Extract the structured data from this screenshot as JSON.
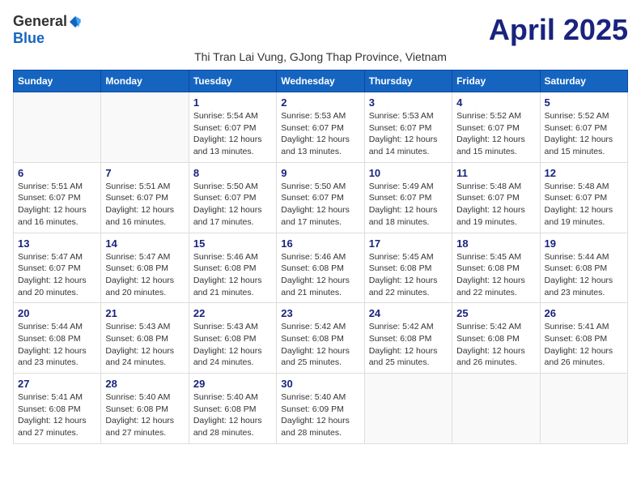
{
  "logo": {
    "general": "General",
    "blue": "Blue"
  },
  "title": "April 2025",
  "subtitle": "Thi Tran Lai Vung, GJong Thap Province, Vietnam",
  "days_of_week": [
    "Sunday",
    "Monday",
    "Tuesday",
    "Wednesday",
    "Thursday",
    "Friday",
    "Saturday"
  ],
  "weeks": [
    [
      {
        "day": "",
        "info": ""
      },
      {
        "day": "",
        "info": ""
      },
      {
        "day": "1",
        "info": "Sunrise: 5:54 AM\nSunset: 6:07 PM\nDaylight: 12 hours and 13 minutes."
      },
      {
        "day": "2",
        "info": "Sunrise: 5:53 AM\nSunset: 6:07 PM\nDaylight: 12 hours and 13 minutes."
      },
      {
        "day": "3",
        "info": "Sunrise: 5:53 AM\nSunset: 6:07 PM\nDaylight: 12 hours and 14 minutes."
      },
      {
        "day": "4",
        "info": "Sunrise: 5:52 AM\nSunset: 6:07 PM\nDaylight: 12 hours and 15 minutes."
      },
      {
        "day": "5",
        "info": "Sunrise: 5:52 AM\nSunset: 6:07 PM\nDaylight: 12 hours and 15 minutes."
      }
    ],
    [
      {
        "day": "6",
        "info": "Sunrise: 5:51 AM\nSunset: 6:07 PM\nDaylight: 12 hours and 16 minutes."
      },
      {
        "day": "7",
        "info": "Sunrise: 5:51 AM\nSunset: 6:07 PM\nDaylight: 12 hours and 16 minutes."
      },
      {
        "day": "8",
        "info": "Sunrise: 5:50 AM\nSunset: 6:07 PM\nDaylight: 12 hours and 17 minutes."
      },
      {
        "day": "9",
        "info": "Sunrise: 5:50 AM\nSunset: 6:07 PM\nDaylight: 12 hours and 17 minutes."
      },
      {
        "day": "10",
        "info": "Sunrise: 5:49 AM\nSunset: 6:07 PM\nDaylight: 12 hours and 18 minutes."
      },
      {
        "day": "11",
        "info": "Sunrise: 5:48 AM\nSunset: 6:07 PM\nDaylight: 12 hours and 19 minutes."
      },
      {
        "day": "12",
        "info": "Sunrise: 5:48 AM\nSunset: 6:07 PM\nDaylight: 12 hours and 19 minutes."
      }
    ],
    [
      {
        "day": "13",
        "info": "Sunrise: 5:47 AM\nSunset: 6:07 PM\nDaylight: 12 hours and 20 minutes."
      },
      {
        "day": "14",
        "info": "Sunrise: 5:47 AM\nSunset: 6:08 PM\nDaylight: 12 hours and 20 minutes."
      },
      {
        "day": "15",
        "info": "Sunrise: 5:46 AM\nSunset: 6:08 PM\nDaylight: 12 hours and 21 minutes."
      },
      {
        "day": "16",
        "info": "Sunrise: 5:46 AM\nSunset: 6:08 PM\nDaylight: 12 hours and 21 minutes."
      },
      {
        "day": "17",
        "info": "Sunrise: 5:45 AM\nSunset: 6:08 PM\nDaylight: 12 hours and 22 minutes."
      },
      {
        "day": "18",
        "info": "Sunrise: 5:45 AM\nSunset: 6:08 PM\nDaylight: 12 hours and 22 minutes."
      },
      {
        "day": "19",
        "info": "Sunrise: 5:44 AM\nSunset: 6:08 PM\nDaylight: 12 hours and 23 minutes."
      }
    ],
    [
      {
        "day": "20",
        "info": "Sunrise: 5:44 AM\nSunset: 6:08 PM\nDaylight: 12 hours and 23 minutes."
      },
      {
        "day": "21",
        "info": "Sunrise: 5:43 AM\nSunset: 6:08 PM\nDaylight: 12 hours and 24 minutes."
      },
      {
        "day": "22",
        "info": "Sunrise: 5:43 AM\nSunset: 6:08 PM\nDaylight: 12 hours and 24 minutes."
      },
      {
        "day": "23",
        "info": "Sunrise: 5:42 AM\nSunset: 6:08 PM\nDaylight: 12 hours and 25 minutes."
      },
      {
        "day": "24",
        "info": "Sunrise: 5:42 AM\nSunset: 6:08 PM\nDaylight: 12 hours and 25 minutes."
      },
      {
        "day": "25",
        "info": "Sunrise: 5:42 AM\nSunset: 6:08 PM\nDaylight: 12 hours and 26 minutes."
      },
      {
        "day": "26",
        "info": "Sunrise: 5:41 AM\nSunset: 6:08 PM\nDaylight: 12 hours and 26 minutes."
      }
    ],
    [
      {
        "day": "27",
        "info": "Sunrise: 5:41 AM\nSunset: 6:08 PM\nDaylight: 12 hours and 27 minutes."
      },
      {
        "day": "28",
        "info": "Sunrise: 5:40 AM\nSunset: 6:08 PM\nDaylight: 12 hours and 27 minutes."
      },
      {
        "day": "29",
        "info": "Sunrise: 5:40 AM\nSunset: 6:08 PM\nDaylight: 12 hours and 28 minutes."
      },
      {
        "day": "30",
        "info": "Sunrise: 5:40 AM\nSunset: 6:09 PM\nDaylight: 12 hours and 28 minutes."
      },
      {
        "day": "",
        "info": ""
      },
      {
        "day": "",
        "info": ""
      },
      {
        "day": "",
        "info": ""
      }
    ]
  ]
}
